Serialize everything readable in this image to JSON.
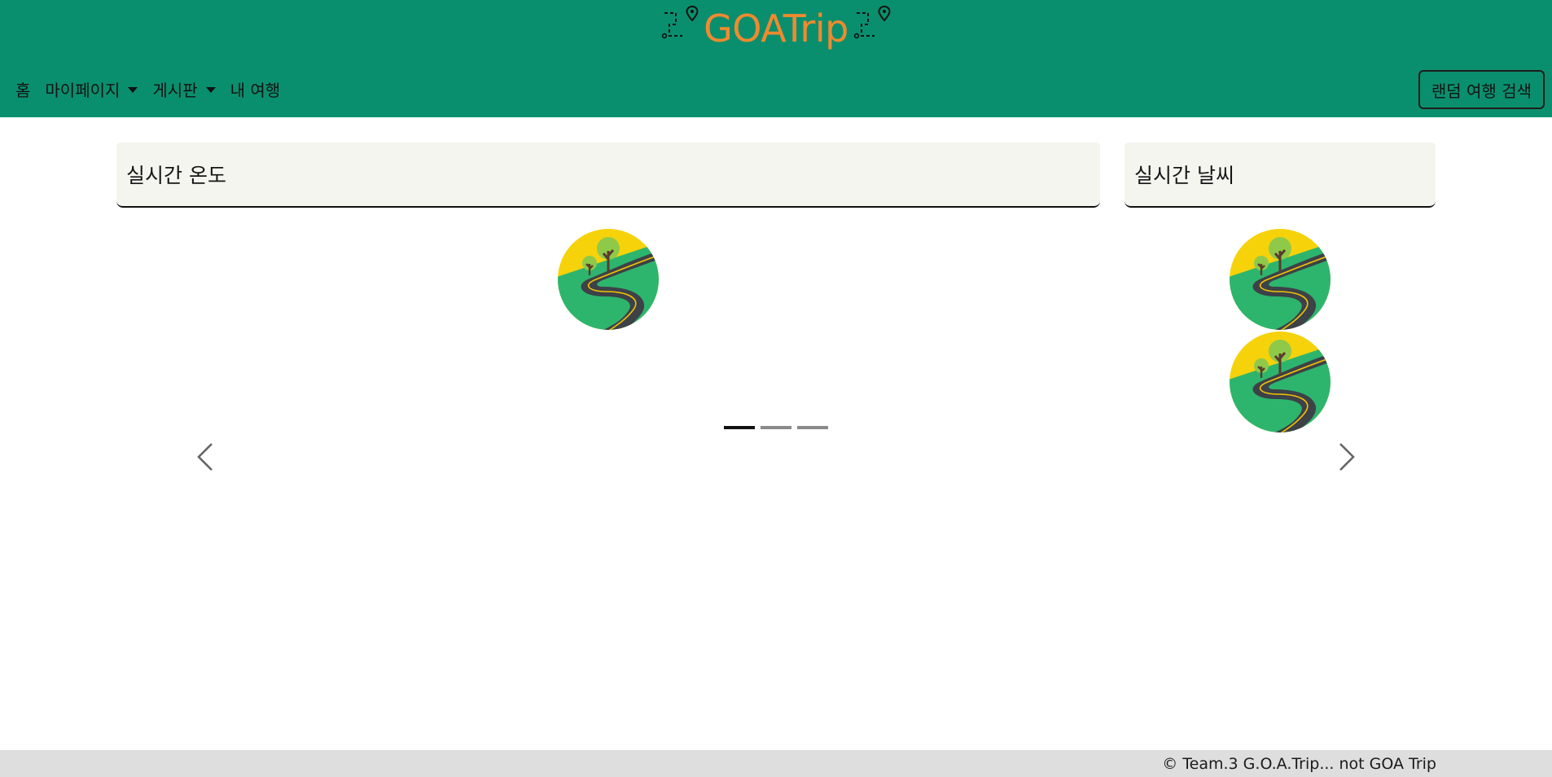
{
  "header": {
    "logo_text": "GOATrip",
    "logo_icon": "route-map-pin-icon",
    "nav": [
      {
        "label": "홈",
        "dropdown": false
      },
      {
        "label": "마이페이지",
        "dropdown": true
      },
      {
        "label": "게시판",
        "dropdown": true
      },
      {
        "label": "내 여행",
        "dropdown": false
      }
    ],
    "random_button_label": "랜덤 여행 검색",
    "background_color": "#0a8f6e",
    "logo_color": "#ef8a2e"
  },
  "cards": {
    "temperature_title": "실시간 온도",
    "weather_title": "실시간 날씨",
    "placeholder_icon": "winding-road-icon"
  },
  "carousel": {
    "slide_count": 3,
    "active_index": 0,
    "prev_icon": "chevron-left-icon",
    "next_icon": "chevron-right-icon"
  },
  "footer": {
    "text": "©  Team.3 G.O.A.Trip... not GOA Trip"
  }
}
